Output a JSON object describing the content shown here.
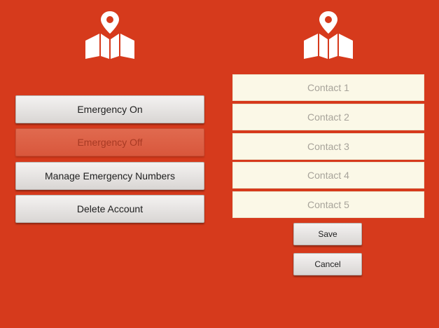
{
  "left_panel": {
    "logo_icon": "map-pin-icon",
    "buttons": [
      {
        "label": "Emergency On",
        "enabled": true
      },
      {
        "label": "Emergency Off",
        "enabled": false
      },
      {
        "label": "Manage Emergency Numbers",
        "enabled": true
      },
      {
        "label": "Delete Account",
        "enabled": true
      }
    ]
  },
  "right_panel": {
    "logo_icon": "map-pin-icon",
    "contacts": [
      {
        "placeholder": "Contact 1"
      },
      {
        "placeholder": "Contact 2"
      },
      {
        "placeholder": "Contact 3"
      },
      {
        "placeholder": "Contact 4"
      },
      {
        "placeholder": "Contact 5"
      }
    ],
    "save_label": "Save",
    "cancel_label": "Cancel"
  },
  "colors": {
    "background": "#d63a1c",
    "contact_field": "#fbf8e7",
    "button_face": "#e8e5e3"
  }
}
